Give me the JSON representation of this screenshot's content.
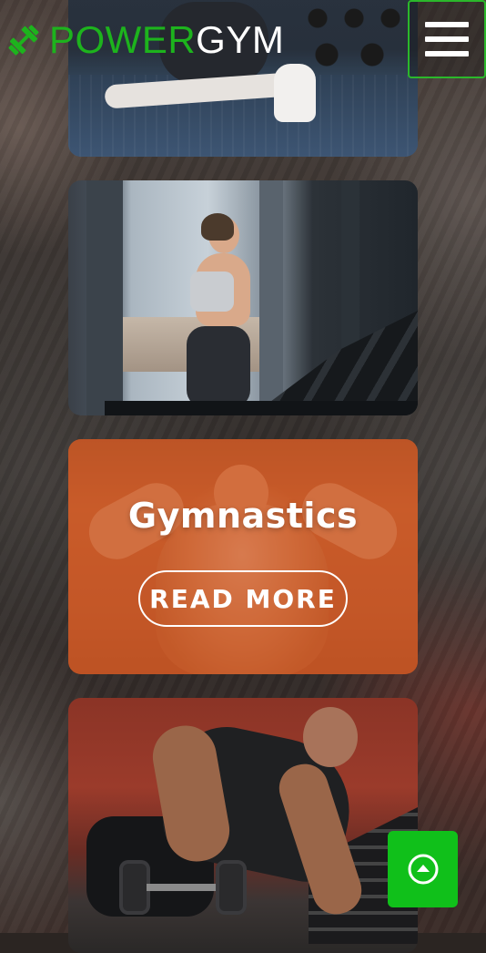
{
  "header": {
    "logo": {
      "icon": "dumbbell-icon",
      "brand_part_1": "POWER",
      "brand_part_2": "GYM"
    },
    "menu_icon": "hamburger-menu-icon"
  },
  "cards": [
    {
      "image": "woman-stretching-on-gym-floor"
    },
    {
      "image": "woman-running-on-treadmill"
    },
    {
      "image": "athlete-flexing-back",
      "title": "Gymnastics",
      "button_label": "READ MORE"
    },
    {
      "image": "man-doing-dumbbell-row"
    }
  ],
  "back_to_top": {
    "icon": "arrow-up-circle-icon"
  },
  "colors": {
    "brand_green": "#1db31d",
    "button_green": "#10c01a",
    "card_overlay_orange": "#cd5a28",
    "white": "#ffffff"
  }
}
